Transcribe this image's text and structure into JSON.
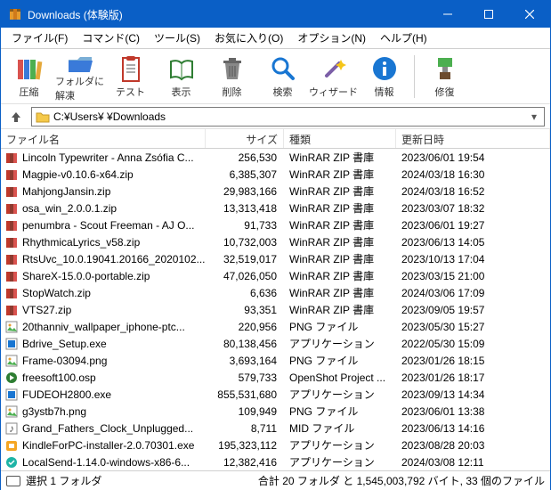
{
  "window": {
    "title": "Downloads (体験版)"
  },
  "menu": {
    "file": "ファイル(F)",
    "command": "コマンド(C)",
    "tools": "ツール(S)",
    "favorites": "お気に入り(O)",
    "options": "オプション(N)",
    "help": "ヘルプ(H)"
  },
  "toolbar": {
    "compress": "圧縮",
    "extract": "フォルダに解凍",
    "test": "テスト",
    "view": "表示",
    "delete": "削除",
    "find": "検索",
    "wizard": "ウィザード",
    "info": "情報",
    "repair": "修復"
  },
  "path": {
    "text": "C:¥Users¥           ¥Downloads"
  },
  "columns": {
    "name": "ファイル名",
    "size": "サイズ",
    "kind": "種類",
    "date": "更新日時"
  },
  "files": [
    {
      "icon": "zip",
      "name": "Lincoln Typewriter - Anna Zsófia C...",
      "size": "256,530",
      "kind": "WinRAR ZIP 書庫",
      "date": "2023/06/01 19:54"
    },
    {
      "icon": "zip",
      "name": "Magpie-v0.10.6-x64.zip",
      "size": "6,385,307",
      "kind": "WinRAR ZIP 書庫",
      "date": "2024/03/18 16:30"
    },
    {
      "icon": "zip",
      "name": "MahjongJansin.zip",
      "size": "29,983,166",
      "kind": "WinRAR ZIP 書庫",
      "date": "2024/03/18 16:52"
    },
    {
      "icon": "zip",
      "name": "osa_win_2.0.0.1.zip",
      "size": "13,313,418",
      "kind": "WinRAR ZIP 書庫",
      "date": "2023/03/07 18:32"
    },
    {
      "icon": "zip",
      "name": "penumbra - Scout Freeman - AJ O...",
      "size": "91,733",
      "kind": "WinRAR ZIP 書庫",
      "date": "2023/06/01 19:27"
    },
    {
      "icon": "zip",
      "name": "RhythmicaLyrics_v58.zip",
      "size": "10,732,003",
      "kind": "WinRAR ZIP 書庫",
      "date": "2023/06/13 14:05"
    },
    {
      "icon": "zip",
      "name": "RtsUvc_10.0.19041.20166_2020102...",
      "size": "32,519,017",
      "kind": "WinRAR ZIP 書庫",
      "date": "2023/10/13 17:04"
    },
    {
      "icon": "zip",
      "name": "ShareX-15.0.0-portable.zip",
      "size": "47,026,050",
      "kind": "WinRAR ZIP 書庫",
      "date": "2023/03/15 21:00"
    },
    {
      "icon": "zip",
      "name": "StopWatch.zip",
      "size": "6,636",
      "kind": "WinRAR ZIP 書庫",
      "date": "2024/03/06 17:09"
    },
    {
      "icon": "zip",
      "name": "VTS27.zip",
      "size": "93,351",
      "kind": "WinRAR ZIP 書庫",
      "date": "2023/09/05 19:57"
    },
    {
      "icon": "png",
      "name": "20thanniv_wallpaper_iphone-ptc...",
      "size": "220,956",
      "kind": "PNG ファイル",
      "date": "2023/05/30 15:27"
    },
    {
      "icon": "exe",
      "name": "Bdrive_Setup.exe",
      "size": "80,138,456",
      "kind": "アプリケーション",
      "date": "2022/05/30 15:09"
    },
    {
      "icon": "png",
      "name": "Frame-03094.png",
      "size": "3,693,164",
      "kind": "PNG ファイル",
      "date": "2023/01/26 18:15"
    },
    {
      "icon": "osp",
      "name": "freesoft100.osp",
      "size": "579,733",
      "kind": "OpenShot Project ...",
      "date": "2023/01/26 18:17"
    },
    {
      "icon": "exe",
      "name": "FUDEOH2800.exe",
      "size": "855,531,680",
      "kind": "アプリケーション",
      "date": "2023/09/13 14:34"
    },
    {
      "icon": "png",
      "name": "g3ystb7h.png",
      "size": "109,949",
      "kind": "PNG ファイル",
      "date": "2023/06/01 13:38"
    },
    {
      "icon": "mid",
      "name": "Grand_Fathers_Clock_Unplugged...",
      "size": "8,711",
      "kind": "MID ファイル",
      "date": "2023/06/13 14:16"
    },
    {
      "icon": "exe2",
      "name": "KindleForPC-installer-2.0.70301.exe",
      "size": "195,323,112",
      "kind": "アプリケーション",
      "date": "2023/08/28 20:03"
    },
    {
      "icon": "exe3",
      "name": "LocalSend-1.14.0-windows-x86-6...",
      "size": "12,382,416",
      "kind": "アプリケーション",
      "date": "2024/03/08 12:11"
    }
  ],
  "status": {
    "left": "選択 1 フォルダ",
    "right": "合計 20 フォルダ と 1,545,003,792 バイト, 33 個のファイル"
  }
}
